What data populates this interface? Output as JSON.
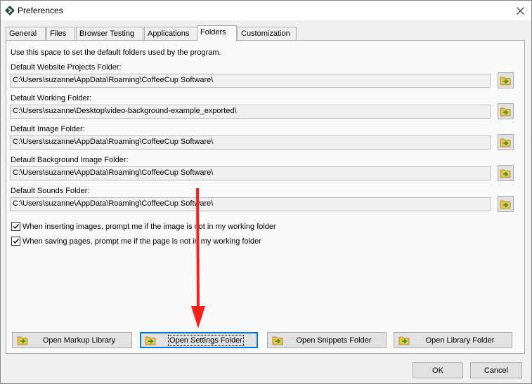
{
  "window": {
    "title": "Preferences"
  },
  "tabs": [
    {
      "label": "General",
      "active": false
    },
    {
      "label": "Files",
      "active": false
    },
    {
      "label": "Browser Testing",
      "active": false
    },
    {
      "label": "Applications",
      "active": false
    },
    {
      "label": "Folders",
      "active": true
    },
    {
      "label": "Customization",
      "active": false
    }
  ],
  "folders": {
    "description": "Use this space to set the default folders used by the program.",
    "items": [
      {
        "label": "Default Website Projects Folder:",
        "value": "C:\\Users\\suzanne\\AppData\\Roaming\\CoffeeCup Software\\"
      },
      {
        "label": "Default Working Folder:",
        "value": "C:\\Users\\suzanne\\Desktop\\video-background-example_exported\\"
      },
      {
        "label": "Default Image Folder:",
        "value": "C:\\Users\\suzanne\\AppData\\Roaming\\CoffeeCup Software\\"
      },
      {
        "label": "Default Background Image Folder:",
        "value": "C:\\Users\\suzanne\\AppData\\Roaming\\CoffeeCup Software\\"
      },
      {
        "label": "Default Sounds Folder:",
        "value": "C:\\Users\\suzanne\\AppData\\Roaming\\CoffeeCup Software\\"
      }
    ],
    "checkboxes": [
      {
        "label": "When inserting images, prompt me if the image is not in my working folder",
        "checked": true
      },
      {
        "label": "When saving pages, prompt me if the page is not in my working folder",
        "checked": true
      }
    ]
  },
  "actions": {
    "open_markup_library": "Open Markup Library",
    "open_settings_folder": "Open Settings Folder",
    "open_snippets_folder": "Open Snippets Folder",
    "open_library_folder": "Open Library Folder"
  },
  "dialog": {
    "ok": "OK",
    "cancel": "Cancel"
  },
  "colors": {
    "accent": "#0078d7",
    "annotation_arrow": "#ff1e1e",
    "folder_icon": "#e8c04a",
    "folder_arrow": "#2e9e2e"
  }
}
